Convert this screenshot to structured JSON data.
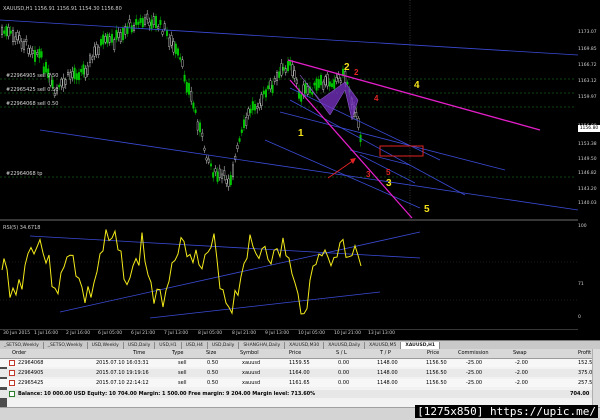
{
  "chart": {
    "symbol_info": "XAUUSD,H1 1156.91 1156.91 1154.30 1156.80",
    "indicator_label": "RSI(5) 34.6718",
    "price_ticks": [
      "1173.07",
      "1169.85",
      "1166.72",
      "1163.12",
      "1159.97",
      "1156.00",
      "1153.38",
      "1149.50",
      "1146.82",
      "1143.20",
      "1140.03"
    ],
    "current_price": "1156.80",
    "rsi_ticks": [
      "100",
      "71",
      "0"
    ],
    "time_ticks": [
      "30 Jun 2015",
      "1 Jul 16:00",
      "2 Jul 16:00",
      "6 Jul 05:00",
      "6 Jul 21:00",
      "7 Jul 13:00",
      "8 Jul 05:00",
      "8 Jul 21:00",
      "9 Jul 13:00",
      "10 Jul 05:00",
      "10 Jul 21:00",
      "13 Jul 13:00"
    ],
    "order_levels": [
      {
        "text": "#22964905 sell 0.50"
      },
      {
        "text": "#22965425 sell 0.50"
      },
      {
        "text": "#22964068 sell 0.50"
      },
      {
        "text": "#22964068 tp"
      }
    ],
    "wave_labels": [
      {
        "text": "1",
        "color": "#f4e21a"
      },
      {
        "text": "2",
        "color": "#f4e21a"
      },
      {
        "text": "2",
        "color": "#e12323"
      },
      {
        "text": "3",
        "color": "#f4e21a"
      },
      {
        "text": "3",
        "color": "#e12323"
      },
      {
        "text": "4",
        "color": "#f4e21a"
      },
      {
        "text": "4",
        "color": "#e12323"
      },
      {
        "text": "5",
        "color": "#f4e21a"
      },
      {
        "text": "5",
        "color": "#e12323"
      }
    ],
    "colors": {
      "bull": "#00c800",
      "trend": "#3b4bd6",
      "magenta": "#e21ec8",
      "rsi": "#f3ea1a",
      "box": "#e12323",
      "pattern": "#7a32c8"
    }
  },
  "chart_tabs": [
    "_SETSO,Weekly",
    "_SETSO,Weekly",
    "USD,Weekly",
    "USD,Daily",
    "USD,H1",
    "USD,H4",
    "USD,Daily",
    "SHANGHAI,Daily",
    "XAUUSD,M30",
    "XAUUSD,Daily",
    "XAUUSD,M5",
    "XAUUSD,H1"
  ],
  "terminal": {
    "columns": [
      "Order",
      "Time",
      "Type",
      "Size",
      "Symbol",
      "Price",
      "S / L",
      "T / P",
      "Price",
      "Commission",
      "Swap",
      "Profit"
    ],
    "rows": [
      {
        "order": "22964068",
        "time": "2015.07.10 16:03:31",
        "type": "sell",
        "size": "0.50",
        "symbol": "xauusd",
        "price": "1159.55",
        "sl": "0.00",
        "tp": "1148.00",
        "cur": "1156.50",
        "commission": "-25.00",
        "swap": "-2.00",
        "profit": "152.50"
      },
      {
        "order": "22964905",
        "time": "2015.07.10 19:19:16",
        "type": "sell",
        "size": "0.50",
        "symbol": "xauusd",
        "price": "1164.00",
        "sl": "0.00",
        "tp": "1148.00",
        "cur": "1156.50",
        "commission": "-25.00",
        "swap": "-2.00",
        "profit": "375.00"
      },
      {
        "order": "22965425",
        "time": "2015.07.10 22:14:12",
        "type": "sell",
        "size": "0.50",
        "symbol": "xauusd",
        "price": "1161.65",
        "sl": "0.00",
        "tp": "1148.00",
        "cur": "1156.50",
        "commission": "-25.00",
        "swap": "-2.00",
        "profit": "257.50"
      }
    ],
    "balance_line": "Balance: 10 000.00 USD  Equity: 10 704.00  Margin: 1 500.00  Free margin: 9 204.00  Margin level: 713.60%",
    "total_profit": "704.00"
  },
  "watermark": "[1275x850] https://upic.me/"
}
